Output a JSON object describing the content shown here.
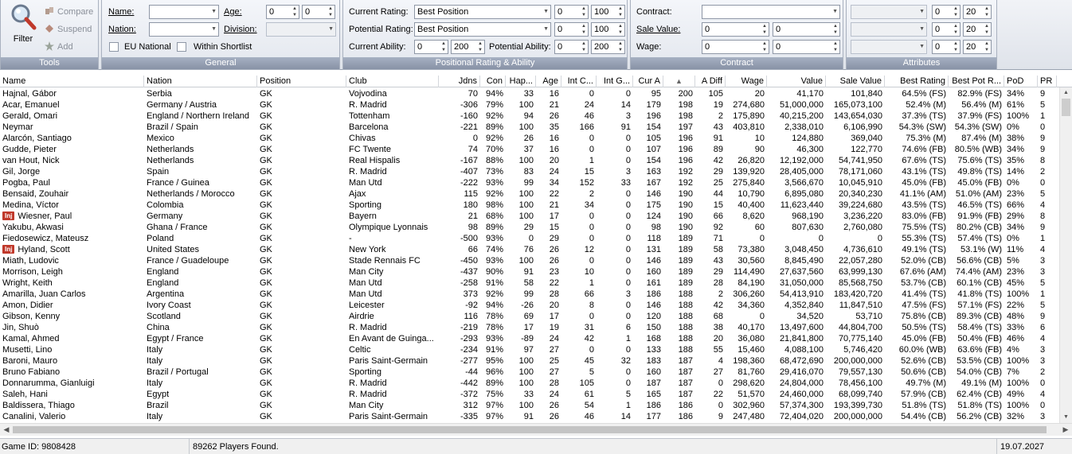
{
  "tools": {
    "title": "Tools",
    "filter": "Filter",
    "compare": "Compare",
    "suspend": "Suspend",
    "add": "Add"
  },
  "general": {
    "title": "General",
    "name_label": "Name:",
    "nation_label": "Nation:",
    "age_label": "Age:",
    "age_min": "0",
    "age_max": "0",
    "division_label": "Division:",
    "eu_label": "EU National",
    "shortlist_label": "Within Shortlist"
  },
  "positional": {
    "title": "Positional Rating & Ability",
    "current_rating_label": "Current Rating:",
    "current_rating_value": "Best Position",
    "current_rating_min": "0",
    "current_rating_max": "100",
    "potential_rating_label": "Potential Rating:",
    "potential_rating_value": "Best Position",
    "potential_rating_min": "0",
    "potential_rating_max": "100",
    "current_ability_label": "Current Ability:",
    "current_ability_min": "0",
    "current_ability_max": "200",
    "potential_ability_label": "Potential Ability:",
    "potential_ability_min": "0",
    "potential_ability_max": "200"
  },
  "contract": {
    "title": "Contract",
    "contract_label": "Contract:",
    "sale_label": "Sale Value:",
    "sale_min": "0",
    "sale_max": "0",
    "wage_label": "Wage:",
    "wage_min": "0",
    "wage_max": "0"
  },
  "attributes": {
    "title": "Attributes",
    "rows": [
      {
        "min": "0",
        "max": "20"
      },
      {
        "min": "0",
        "max": "20"
      },
      {
        "min": "0",
        "max": "20"
      }
    ]
  },
  "columns": [
    "Name",
    "Nation",
    "Position",
    "Club",
    "Jdns",
    "Con",
    "Hap...",
    "Age",
    "Int C...",
    "Int G...",
    "Cur A",
    "",
    "A Diff",
    "Wage",
    "Value",
    "Sale Value",
    "Best Rating",
    "Best Pot R...",
    "PoD",
    "PR"
  ],
  "sort_indicator": "▲",
  "injury_badge": "Inj",
  "rows": [
    {
      "name": "Hajnal, Gábor",
      "inj": false,
      "nation": "Serbia",
      "pos": "GK",
      "club": "Vojvodina",
      "jdns": "70",
      "con": "94%",
      "hap": "33",
      "age": "16",
      "intc": "0",
      "intg": "0",
      "cura": "95",
      "pota": "200",
      "adiff": "105",
      "wage": "20",
      "value": "41,170",
      "sale": "101,840",
      "best": "64.5% (FS)",
      "bestpot": "82.9% (FS)",
      "pod": "34%",
      "pr": "9"
    },
    {
      "name": "Acar, Emanuel",
      "inj": false,
      "nation": "Germany / Austria",
      "pos": "GK",
      "club": "R. Madrid",
      "jdns": "-306",
      "con": "79%",
      "hap": "100",
      "age": "21",
      "intc": "24",
      "intg": "14",
      "cura": "179",
      "pota": "198",
      "adiff": "19",
      "wage": "274,680",
      "value": "51,000,000",
      "sale": "165,073,100",
      "best": "52.4% (M)",
      "bestpot": "56.4% (M)",
      "pod": "61%",
      "pr": "5"
    },
    {
      "name": "Gerald, Omari",
      "inj": false,
      "nation": "England / Northern Ireland",
      "pos": "GK",
      "club": "Tottenham",
      "jdns": "-160",
      "con": "92%",
      "hap": "94",
      "age": "26",
      "intc": "46",
      "intg": "3",
      "cura": "196",
      "pota": "198",
      "adiff": "2",
      "wage": "175,890",
      "value": "40,215,200",
      "sale": "143,654,030",
      "best": "37.3% (TS)",
      "bestpot": "37.9% (FS)",
      "pod": "100%",
      "pr": "1"
    },
    {
      "name": "Neymar",
      "inj": false,
      "nation": "Brazil / Spain",
      "pos": "GK",
      "club": "Barcelona",
      "jdns": "-221",
      "con": "89%",
      "hap": "100",
      "age": "35",
      "intc": "166",
      "intg": "91",
      "cura": "154",
      "pota": "197",
      "adiff": "43",
      "wage": "403,810",
      "value": "2,338,010",
      "sale": "6,106,990",
      "best": "54.3% (SW)",
      "bestpot": "54.3% (SW)",
      "pod": "0%",
      "pr": "0"
    },
    {
      "name": "Alarcón, Santiago",
      "inj": false,
      "nation": "Mexico",
      "pos": "GK",
      "club": "Chivas",
      "jdns": "0",
      "con": "92%",
      "hap": "26",
      "age": "16",
      "intc": "0",
      "intg": "0",
      "cura": "105",
      "pota": "196",
      "adiff": "91",
      "wage": "10",
      "value": "124,880",
      "sale": "369,040",
      "best": "75.3% (M)",
      "bestpot": "87.4% (M)",
      "pod": "38%",
      "pr": "9"
    },
    {
      "name": "Gudde, Pieter",
      "inj": false,
      "nation": "Netherlands",
      "pos": "GK",
      "club": "FC Twente",
      "jdns": "74",
      "con": "70%",
      "hap": "37",
      "age": "16",
      "intc": "0",
      "intg": "0",
      "cura": "107",
      "pota": "196",
      "adiff": "89",
      "wage": "90",
      "value": "46,300",
      "sale": "122,770",
      "best": "74.6% (FB)",
      "bestpot": "80.5% (WB)",
      "pod": "34%",
      "pr": "9"
    },
    {
      "name": "van Hout, Nick",
      "inj": false,
      "nation": "Netherlands",
      "pos": "GK",
      "club": "Real Hispalis",
      "jdns": "-167",
      "con": "88%",
      "hap": "100",
      "age": "20",
      "intc": "1",
      "intg": "0",
      "cura": "154",
      "pota": "196",
      "adiff": "42",
      "wage": "26,820",
      "value": "12,192,000",
      "sale": "54,741,950",
      "best": "67.6% (TS)",
      "bestpot": "75.6% (TS)",
      "pod": "35%",
      "pr": "8"
    },
    {
      "name": "Gil, Jorge",
      "inj": false,
      "nation": "Spain",
      "pos": "GK",
      "club": "R. Madrid",
      "jdns": "-407",
      "con": "73%",
      "hap": "83",
      "age": "24",
      "intc": "15",
      "intg": "3",
      "cura": "163",
      "pota": "192",
      "adiff": "29",
      "wage": "139,920",
      "value": "28,405,000",
      "sale": "78,171,060",
      "best": "43.1% (TS)",
      "bestpot": "49.8% (TS)",
      "pod": "14%",
      "pr": "2"
    },
    {
      "name": "Pogba, Paul",
      "inj": false,
      "nation": "France / Guinea",
      "pos": "GK",
      "club": "Man Utd",
      "jdns": "-222",
      "con": "93%",
      "hap": "99",
      "age": "34",
      "intc": "152",
      "intg": "33",
      "cura": "167",
      "pota": "192",
      "adiff": "25",
      "wage": "275,840",
      "value": "3,566,670",
      "sale": "10,045,910",
      "best": "45.0% (FB)",
      "bestpot": "45.0% (FB)",
      "pod": "0%",
      "pr": "0"
    },
    {
      "name": "Bensaid, Zouhair",
      "inj": false,
      "nation": "Netherlands / Morocco",
      "pos": "GK",
      "club": "Ajax",
      "jdns": "115",
      "con": "92%",
      "hap": "100",
      "age": "22",
      "intc": "2",
      "intg": "0",
      "cura": "146",
      "pota": "190",
      "adiff": "44",
      "wage": "10,790",
      "value": "6,895,080",
      "sale": "20,340,230",
      "best": "41.1% (AM)",
      "bestpot": "51.0% (AM)",
      "pod": "23%",
      "pr": "5"
    },
    {
      "name": "Medina, Víctor",
      "inj": false,
      "nation": "Colombia",
      "pos": "GK",
      "club": "Sporting",
      "jdns": "180",
      "con": "98%",
      "hap": "100",
      "age": "21",
      "intc": "34",
      "intg": "0",
      "cura": "175",
      "pota": "190",
      "adiff": "15",
      "wage": "40,400",
      "value": "11,623,440",
      "sale": "39,224,680",
      "best": "43.5% (TS)",
      "bestpot": "46.5% (TS)",
      "pod": "66%",
      "pr": "4"
    },
    {
      "name": "Wiesner, Paul",
      "inj": true,
      "nation": "Germany",
      "pos": "GK",
      "club": "Bayern",
      "jdns": "21",
      "con": "68%",
      "hap": "100",
      "age": "17",
      "intc": "0",
      "intg": "0",
      "cura": "124",
      "pota": "190",
      "adiff": "66",
      "wage": "8,620",
      "value": "968,190",
      "sale": "3,236,220",
      "best": "83.0% (FB)",
      "bestpot": "91.9% (FB)",
      "pod": "29%",
      "pr": "8"
    },
    {
      "name": "Yakubu, Akwasi",
      "inj": false,
      "nation": "Ghana / France",
      "pos": "GK",
      "club": "Olympique Lyonnais",
      "jdns": "98",
      "con": "89%",
      "hap": "29",
      "age": "15",
      "intc": "0",
      "intg": "0",
      "cura": "98",
      "pota": "190",
      "adiff": "92",
      "wage": "60",
      "value": "807,630",
      "sale": "2,760,080",
      "best": "75.5% (TS)",
      "bestpot": "80.2% (CB)",
      "pod": "34%",
      "pr": "9"
    },
    {
      "name": "Fiedosewicz, Mateusz",
      "inj": false,
      "nation": "Poland",
      "pos": "GK",
      "club": "-",
      "jdns": "-500",
      "con": "93%",
      "hap": "0",
      "age": "29",
      "intc": "0",
      "intg": "0",
      "cura": "118",
      "pota": "189",
      "adiff": "71",
      "wage": "0",
      "value": "0",
      "sale": "0",
      "best": "55.3% (TS)",
      "bestpot": "57.4% (TS)",
      "pod": "0%",
      "pr": "1"
    },
    {
      "name": "Hyland, Scott",
      "inj": true,
      "nation": "United States",
      "pos": "GK",
      "club": "New York",
      "jdns": "66",
      "con": "74%",
      "hap": "76",
      "age": "26",
      "intc": "12",
      "intg": "0",
      "cura": "131",
      "pota": "189",
      "adiff": "58",
      "wage": "73,380",
      "value": "3,048,450",
      "sale": "4,736,610",
      "best": "49.1% (TS)",
      "bestpot": "53.1% (W)",
      "pod": "11%",
      "pr": "4"
    },
    {
      "name": "Miath, Ludovic",
      "inj": false,
      "nation": "France / Guadeloupe",
      "pos": "GK",
      "club": "Stade Rennais FC",
      "jdns": "-450",
      "con": "93%",
      "hap": "100",
      "age": "26",
      "intc": "0",
      "intg": "0",
      "cura": "146",
      "pota": "189",
      "adiff": "43",
      "wage": "30,560",
      "value": "8,845,490",
      "sale": "22,057,280",
      "best": "52.0% (CB)",
      "bestpot": "56.6% (CB)",
      "pod": "5%",
      "pr": "3"
    },
    {
      "name": "Morrison, Leigh",
      "inj": false,
      "nation": "England",
      "pos": "GK",
      "club": "Man City",
      "jdns": "-437",
      "con": "90%",
      "hap": "91",
      "age": "23",
      "intc": "10",
      "intg": "0",
      "cura": "160",
      "pota": "189",
      "adiff": "29",
      "wage": "114,490",
      "value": "27,637,560",
      "sale": "63,999,130",
      "best": "67.6% (AM)",
      "bestpot": "74.4% (AM)",
      "pod": "23%",
      "pr": "3"
    },
    {
      "name": "Wright, Keith",
      "inj": false,
      "nation": "England",
      "pos": "GK",
      "club": "Man Utd",
      "jdns": "-258",
      "con": "91%",
      "hap": "58",
      "age": "22",
      "intc": "1",
      "intg": "0",
      "cura": "161",
      "pota": "189",
      "adiff": "28",
      "wage": "84,190",
      "value": "31,050,000",
      "sale": "85,568,750",
      "best": "53.7% (CB)",
      "bestpot": "60.1% (CB)",
      "pod": "45%",
      "pr": "5"
    },
    {
      "name": "Amarilla, Juan Carlos",
      "inj": false,
      "nation": "Argentina",
      "pos": "GK",
      "club": "Man Utd",
      "jdns": "373",
      "con": "92%",
      "hap": "99",
      "age": "28",
      "intc": "66",
      "intg": "3",
      "cura": "186",
      "pota": "188",
      "adiff": "2",
      "wage": "306,260",
      "value": "54,413,910",
      "sale": "183,420,720",
      "best": "41.4% (TS)",
      "bestpot": "41.8% (TS)",
      "pod": "100%",
      "pr": "1"
    },
    {
      "name": "Amon, Didier",
      "inj": false,
      "nation": "Ivory Coast",
      "pos": "GK",
      "club": "Leicester",
      "jdns": "-92",
      "con": "94%",
      "hap": "-26",
      "age": "20",
      "intc": "8",
      "intg": "0",
      "cura": "146",
      "pota": "188",
      "adiff": "42",
      "wage": "34,360",
      "value": "4,352,840",
      "sale": "11,847,510",
      "best": "47.5% (FS)",
      "bestpot": "57.1% (FS)",
      "pod": "22%",
      "pr": "5"
    },
    {
      "name": "Gibson, Kenny",
      "inj": false,
      "nation": "Scotland",
      "pos": "GK",
      "club": "Airdrie",
      "jdns": "116",
      "con": "78%",
      "hap": "69",
      "age": "17",
      "intc": "0",
      "intg": "0",
      "cura": "120",
      "pota": "188",
      "adiff": "68",
      "wage": "0",
      "value": "34,520",
      "sale": "53,710",
      "best": "75.8% (CB)",
      "bestpot": "89.3% (CB)",
      "pod": "48%",
      "pr": "9"
    },
    {
      "name": "Jin, Shuò",
      "inj": false,
      "nation": "China",
      "pos": "GK",
      "club": "R. Madrid",
      "jdns": "-219",
      "con": "78%",
      "hap": "17",
      "age": "19",
      "intc": "31",
      "intg": "6",
      "cura": "150",
      "pota": "188",
      "adiff": "38",
      "wage": "40,170",
      "value": "13,497,600",
      "sale": "44,804,700",
      "best": "50.5% (TS)",
      "bestpot": "58.4% (TS)",
      "pod": "33%",
      "pr": "6"
    },
    {
      "name": "Kamal, Ahmed",
      "inj": false,
      "nation": "Egypt / France",
      "pos": "GK",
      "club": "En Avant de Guinga...",
      "jdns": "-293",
      "con": "93%",
      "hap": "-89",
      "age": "24",
      "intc": "42",
      "intg": "1",
      "cura": "168",
      "pota": "188",
      "adiff": "20",
      "wage": "36,080",
      "value": "21,841,800",
      "sale": "70,775,140",
      "best": "45.0% (FB)",
      "bestpot": "50.4% (FB)",
      "pod": "46%",
      "pr": "4"
    },
    {
      "name": "Musetti, Lino",
      "inj": false,
      "nation": "Italy",
      "pos": "GK",
      "club": "Celtic",
      "jdns": "-234",
      "con": "91%",
      "hap": "97",
      "age": "27",
      "intc": "0",
      "intg": "0",
      "cura": "133",
      "pota": "188",
      "adiff": "55",
      "wage": "15,460",
      "value": "4,088,100",
      "sale": "5,746,420",
      "best": "60.0% (WB)",
      "bestpot": "63.6% (FB)",
      "pod": "4%",
      "pr": "3"
    },
    {
      "name": "Baroni, Mauro",
      "inj": false,
      "nation": "Italy",
      "pos": "GK",
      "club": "Paris Saint-Germain",
      "jdns": "-277",
      "con": "95%",
      "hap": "100",
      "age": "25",
      "intc": "45",
      "intg": "32",
      "cura": "183",
      "pota": "187",
      "adiff": "4",
      "wage": "198,360",
      "value": "68,472,690",
      "sale": "200,000,000",
      "best": "52.6% (CB)",
      "bestpot": "53.5% (CB)",
      "pod": "100%",
      "pr": "3"
    },
    {
      "name": "Bruno Fabiano",
      "inj": false,
      "nation": "Brazil / Portugal",
      "pos": "GK",
      "club": "Sporting",
      "jdns": "-44",
      "con": "96%",
      "hap": "100",
      "age": "27",
      "intc": "5",
      "intg": "0",
      "cura": "160",
      "pota": "187",
      "adiff": "27",
      "wage": "81,760",
      "value": "29,416,070",
      "sale": "79,557,130",
      "best": "50.6% (CB)",
      "bestpot": "54.0% (CB)",
      "pod": "7%",
      "pr": "2"
    },
    {
      "name": "Donnarumma, Gianluigi",
      "inj": false,
      "nation": "Italy",
      "pos": "GK",
      "club": "R. Madrid",
      "jdns": "-442",
      "con": "89%",
      "hap": "100",
      "age": "28",
      "intc": "105",
      "intg": "0",
      "cura": "187",
      "pota": "187",
      "adiff": "0",
      "wage": "298,620",
      "value": "24,804,000",
      "sale": "78,456,100",
      "best": "49.7% (M)",
      "bestpot": "49.1% (M)",
      "pod": "100%",
      "pr": "0"
    },
    {
      "name": "Saleh, Hani",
      "inj": false,
      "nation": "Egypt",
      "pos": "GK",
      "club": "R. Madrid",
      "jdns": "-372",
      "con": "75%",
      "hap": "33",
      "age": "24",
      "intc": "61",
      "intg": "5",
      "cura": "165",
      "pota": "187",
      "adiff": "22",
      "wage": "51,570",
      "value": "24,460,000",
      "sale": "68,099,740",
      "best": "57.9% (CB)",
      "bestpot": "62.4% (CB)",
      "pod": "49%",
      "pr": "4"
    },
    {
      "name": "Baldissera, Thiago",
      "inj": false,
      "nation": "Brazil",
      "pos": "GK",
      "club": "Man City",
      "jdns": "312",
      "con": "97%",
      "hap": "100",
      "age": "26",
      "intc": "54",
      "intg": "1",
      "cura": "186",
      "pota": "186",
      "adiff": "0",
      "wage": "302,960",
      "value": "57,374,300",
      "sale": "193,399,730",
      "best": "51.8% (TS)",
      "bestpot": "51.8% (TS)",
      "pod": "100%",
      "pr": "0"
    },
    {
      "name": "Canalini, Valerio",
      "inj": false,
      "nation": "Italy",
      "pos": "GK",
      "club": "Paris Saint-Germain",
      "jdns": "-335",
      "con": "97%",
      "hap": "91",
      "age": "26",
      "intc": "46",
      "intg": "14",
      "cura": "177",
      "pota": "186",
      "adiff": "9",
      "wage": "247,480",
      "value": "72,404,020",
      "sale": "200,000,000",
      "best": "54.4% (CB)",
      "bestpot": "56.2% (CB)",
      "pod": "32%",
      "pr": "3"
    }
  ],
  "status": {
    "game_id": "Game ID: 9808428",
    "players_found": "89262 Players Found.",
    "date": "19.07.2027"
  },
  "colors": {
    "group_title": "#8892a6",
    "injury_badge": "#c0392b"
  }
}
